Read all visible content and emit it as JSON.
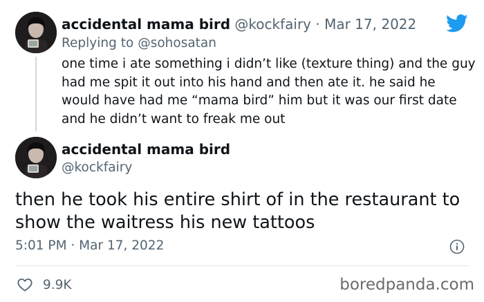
{
  "reply_tweet": {
    "display_name": "accidental mama bird",
    "handle": "@kockfairy",
    "separator": " · ",
    "date": "Mar 17, 2022",
    "replying_prefix": "Replying to ",
    "replying_to": "@sohosatan",
    "text": "one time i ate something i didn’t like (texture thing) and the guy had me spit it out into his hand and then ate it. he said he would have had me “mama bird” him but it was our first date and he didn’t want to freak me out"
  },
  "main_tweet": {
    "display_name": "accidental mama bird",
    "handle": "@kockfairy",
    "text": "then he took his entire shirt of in the restaurant to show the waitress his new tattoos",
    "timestamp": "5:01 PM · Mar 17, 2022",
    "like_count": "9.9K"
  },
  "watermark": "boredpanda.com",
  "icons": {
    "brand": "twitter-bird-icon",
    "info": "info-icon",
    "like": "heart-icon"
  },
  "colors": {
    "twitter_blue": "#1d9bf0",
    "muted_text": "#536471",
    "thread_line": "#cfd9de"
  }
}
